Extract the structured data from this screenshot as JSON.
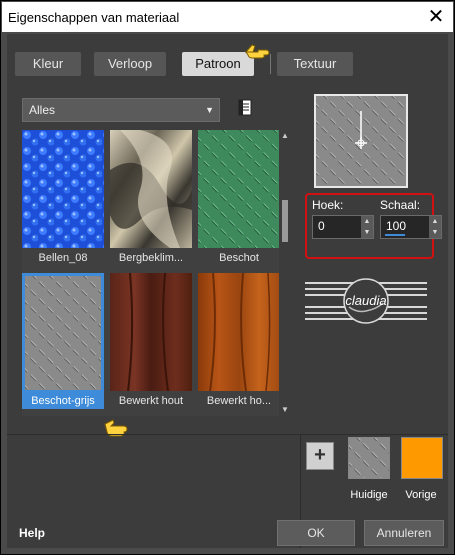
{
  "window": {
    "title": "Eigenschappen van materiaal"
  },
  "tabs": [
    {
      "label": "Kleur",
      "active": false
    },
    {
      "label": "Verloop",
      "active": false
    },
    {
      "label": "Patroon",
      "active": true
    },
    {
      "label": "Textuur",
      "active": false
    }
  ],
  "category": {
    "selected": "Alles"
  },
  "patterns": [
    {
      "label": "Bellen_08",
      "selected": false
    },
    {
      "label": "Bergbeklim...",
      "selected": false
    },
    {
      "label": "Beschot",
      "selected": false
    },
    {
      "label": "Beschot-grijs",
      "selected": true
    },
    {
      "label": "Bewerkt hout",
      "selected": false
    },
    {
      "label": "Bewerkt ho...",
      "selected": false
    }
  ],
  "controls": {
    "angle": {
      "label": "Hoek:",
      "value": "0"
    },
    "scale": {
      "label": "Schaal:",
      "value": "100"
    }
  },
  "watermark": {
    "text": "claudia"
  },
  "swatches": {
    "current_label": "Huidige",
    "previous_label": "Vorige",
    "previous_color": "#ff9900"
  },
  "footer": {
    "help": "Help",
    "ok": "OK",
    "cancel": "Annuleren"
  },
  "colors": {
    "selection": "#3d8bd9",
    "highlight": "#d11111"
  }
}
